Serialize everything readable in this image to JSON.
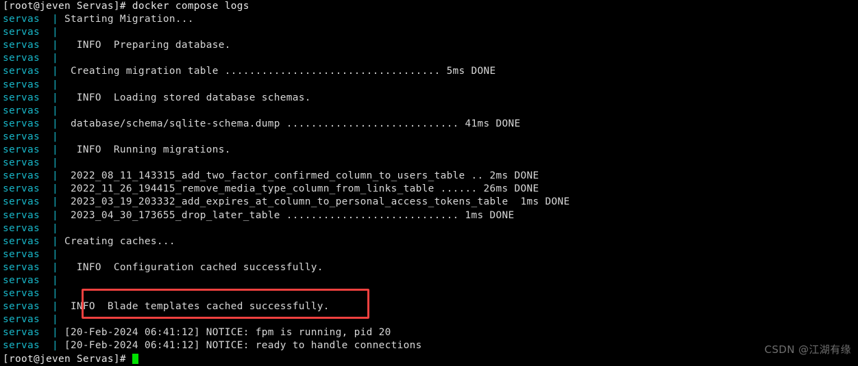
{
  "terminal": {
    "background_color": "#000000",
    "service_color": "#18b6c8",
    "text_color": "#d8d8d8",
    "cursor_color": "#00e000",
    "highlight_color": "#f2413f",
    "command_line": "[root@jeven Servas]# docker compose logs",
    "final_prompt": "[root@jeven Servas]# ",
    "service_label": "servas",
    "pipe": "|",
    "lines": [
      {
        "service": "servas",
        "message": " Starting Migration..."
      },
      {
        "service": "servas",
        "message": ""
      },
      {
        "service": "servas",
        "message": "   INFO  Preparing database."
      },
      {
        "service": "servas",
        "message": ""
      },
      {
        "service": "servas",
        "message": "  Creating migration table ................................... 5ms DONE"
      },
      {
        "service": "servas",
        "message": ""
      },
      {
        "service": "servas",
        "message": "   INFO  Loading stored database schemas."
      },
      {
        "service": "servas",
        "message": ""
      },
      {
        "service": "servas",
        "message": "  database/schema/sqlite-schema.dump ............................ 41ms DONE"
      },
      {
        "service": "servas",
        "message": ""
      },
      {
        "service": "servas",
        "message": "   INFO  Running migrations."
      },
      {
        "service": "servas",
        "message": ""
      },
      {
        "service": "servas",
        "message": "  2022_08_11_143315_add_two_factor_confirmed_column_to_users_table .. 2ms DONE"
      },
      {
        "service": "servas",
        "message": "  2022_11_26_194415_remove_media_type_column_from_links_table ...... 26ms DONE"
      },
      {
        "service": "servas",
        "message": "  2023_03_19_203332_add_expires_at_column_to_personal_access_tokens_table  1ms DONE"
      },
      {
        "service": "servas",
        "message": "  2023_04_30_173655_drop_later_table ............................ 1ms DONE"
      },
      {
        "service": "servas",
        "message": ""
      },
      {
        "service": "servas",
        "message": " Creating caches..."
      },
      {
        "service": "servas",
        "message": ""
      },
      {
        "service": "servas",
        "message": "   INFO  Configuration cached successfully."
      },
      {
        "service": "servas",
        "message": ""
      },
      {
        "service": "servas",
        "message": ""
      },
      {
        "service": "servas",
        "message": "  INFO  Blade templates cached successfully."
      },
      {
        "service": "servas",
        "message": ""
      },
      {
        "service": "servas",
        "message": " [20-Feb-2024 06:41:12] NOTICE: fpm is running, pid 20"
      },
      {
        "service": "servas",
        "message": " [20-Feb-2024 06:41:12] NOTICE: ready to handle connections"
      }
    ]
  },
  "watermark": {
    "text": "CSDN @江湖有缘"
  }
}
